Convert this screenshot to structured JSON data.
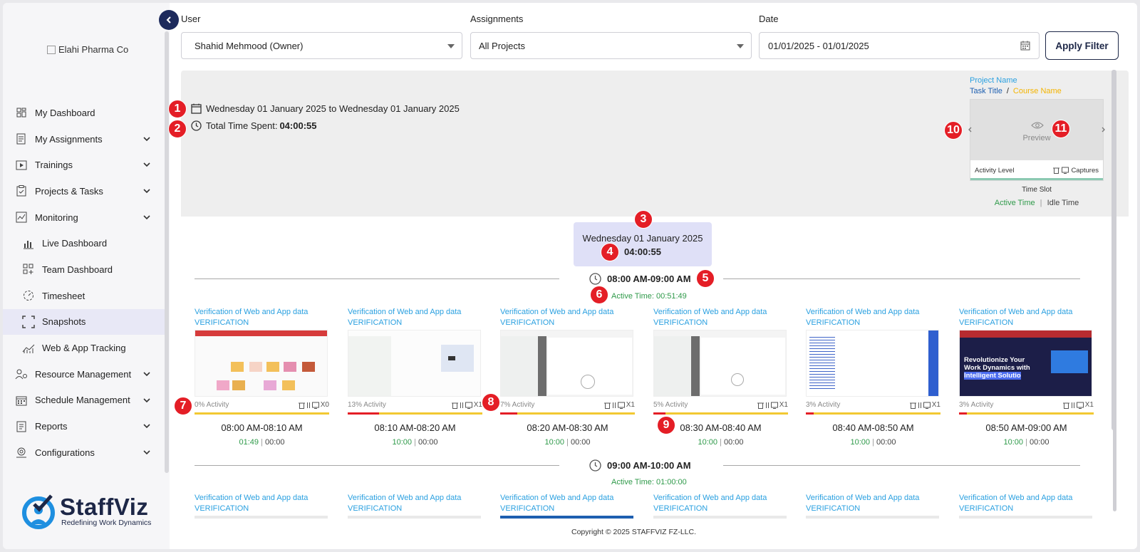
{
  "sidebar": {
    "company_logo_alt": "Elahi Pharma Co",
    "items": [
      {
        "label": "My Dashboard"
      },
      {
        "label": "My Assignments"
      },
      {
        "label": "Trainings"
      },
      {
        "label": "Projects & Tasks"
      },
      {
        "label": "Monitoring"
      },
      {
        "label": "Live Dashboard"
      },
      {
        "label": "Team Dashboard"
      },
      {
        "label": "Timesheet"
      },
      {
        "label": "Snapshots"
      },
      {
        "label": "Web & App Tracking"
      },
      {
        "label": "Resource Management"
      },
      {
        "label": "Schedule Management"
      },
      {
        "label": "Reports"
      },
      {
        "label": "Configurations"
      }
    ],
    "brand_name": "StaffViz",
    "brand_tagline": "Redefining Work Dynamics"
  },
  "filters": {
    "user_label": "User",
    "user_value": "Shahid Mehmood (Owner)",
    "assignments_label": "Assignments",
    "assignments_value": "All Projects",
    "date_label": "Date",
    "date_value": "01/01/2025 - 01/01/2025",
    "apply_label": "Apply Filter"
  },
  "summary": {
    "date_range": "Wednesday 01 January 2025 to Wednesday 01 January 2025",
    "total_label": "Total Time Spent:",
    "total_value": "04:00:55"
  },
  "legend": {
    "project_name": "Project Name",
    "task_title": "Task Title",
    "separator": "/",
    "course_name": "Course Name",
    "preview": "Preview",
    "activity_level": "Activity Level",
    "captures": "Captures",
    "time_slot": "Time Slot",
    "active_time": "Active Time",
    "idle_time": "Idle Time"
  },
  "markers": [
    "1",
    "2",
    "3",
    "4",
    "5",
    "6",
    "7",
    "8",
    "9",
    "10",
    "11"
  ],
  "day": {
    "date": "Wednesday 01 January 2025",
    "total": "04:00:55"
  },
  "hours": [
    {
      "range": "08:00 AM-09:00 AM",
      "active": "Active Time: 00:51:49",
      "cards": [
        {
          "title": "Verification of Web and App data",
          "sub": "VERIFICATION",
          "activity": "0% Activity",
          "activity_pct": 0,
          "captures": "X0",
          "slot": "08:00 AM-08:10 AM",
          "active": "01:49",
          "idle": "00:00"
        },
        {
          "title": "Verification of Web and App data",
          "sub": "VERIFICATION",
          "activity": "13% Activity",
          "activity_pct": 13,
          "captures": "X1",
          "slot": "08:10 AM-08:20 AM",
          "active": "10:00",
          "idle": "00:00"
        },
        {
          "title": "Verification of Web and App data",
          "sub": "VERIFICATION",
          "activity": "7% Activity",
          "activity_pct": 7,
          "captures": "X1",
          "slot": "08:20 AM-08:30 AM",
          "active": "10:00",
          "idle": "00:00"
        },
        {
          "title": "Verification of Web and App data",
          "sub": "VERIFICATION",
          "activity": "5% Activity",
          "activity_pct": 5,
          "captures": "X1",
          "slot": "08:30 AM-08:40 AM",
          "active": "10:00",
          "idle": "00:00"
        },
        {
          "title": "Verification of Web and App data",
          "sub": "VERIFICATION",
          "activity": "3% Activity",
          "activity_pct": 3,
          "captures": "X1",
          "slot": "08:40 AM-08:50 AM",
          "active": "10:00",
          "idle": "00:00"
        },
        {
          "title": "Verification of Web and App data",
          "sub": "VERIFICATION",
          "activity": "3% Activity",
          "activity_pct": 3,
          "captures": "X1",
          "slot": "08:50 AM-09:00 AM",
          "active": "10:00",
          "idle": "00:00"
        }
      ]
    },
    {
      "range": "09:00 AM-10:00 AM",
      "active": "Active Time: 01:00:00",
      "cards": [
        {
          "title": "Verification of Web and App data",
          "sub": "VERIFICATION"
        },
        {
          "title": "Verification of Web and App data",
          "sub": "VERIFICATION"
        },
        {
          "title": "Verification of Web and App data",
          "sub": "VERIFICATION"
        },
        {
          "title": "Verification of Web and App data",
          "sub": "VERIFICATION"
        },
        {
          "title": "Verification of Web and App data",
          "sub": "VERIFICATION"
        },
        {
          "title": "Verification of Web and App data",
          "sub": "VERIFICATION"
        }
      ]
    }
  ],
  "thumb_text": {
    "revolutionize": "Revolutionize Your Work Dynamics with",
    "intelligent": "Intelligent Solutio"
  },
  "colors": {
    "accent": "#1d2a5c",
    "marker": "#e41e26",
    "active_green": "#2f9a4a",
    "link_blue": "#2aa0e0",
    "course_orange": "#f4b400",
    "activity_yellow": "#f2c832"
  },
  "icons": {
    "calendar": "calendar-icon",
    "clock": "clock-icon",
    "eye": "eye-icon",
    "trash": "trash-icon",
    "chevron_left": "chevron-left-icon"
  },
  "footer": {
    "copyright": "Copyright © 2025 STAFFVIZ FZ-LLC."
  }
}
